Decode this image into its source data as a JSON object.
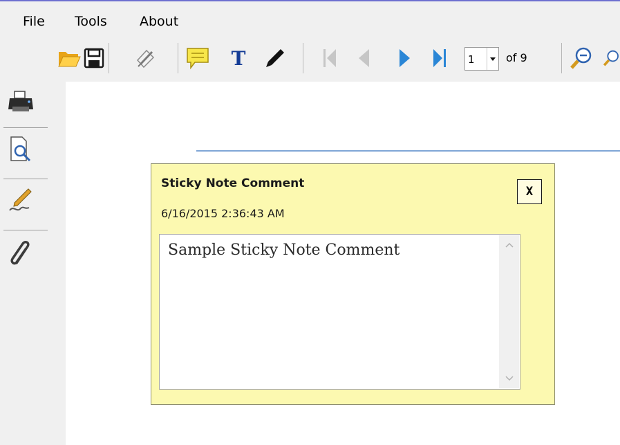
{
  "menu": {
    "file": "File",
    "tools": "Tools",
    "about": "About"
  },
  "toolbar": {
    "page_current": "1",
    "page_of": "of 9",
    "icons": [
      "open-folder-icon",
      "save-icon",
      "sign-pen-icon",
      "sticky-note-icon",
      "text-tool-icon",
      "pencil-icon",
      "first-page-icon",
      "prev-page-icon",
      "next-page-icon",
      "last-page-icon",
      "zoom-out-icon"
    ]
  },
  "sidebar": {
    "icons": [
      "printer-icon",
      "find-icon",
      "signature-icon",
      "attachment-icon"
    ]
  },
  "note": {
    "title": "Sticky Note Comment",
    "date": "6/16/2015 2:36:43 AM",
    "close": "X",
    "content": "Sample Sticky Note Comment"
  },
  "colors": {
    "note_bg": "#fcf9b0",
    "accent_blue": "#2a86d6",
    "chrome_bg": "#f0f0f0"
  }
}
